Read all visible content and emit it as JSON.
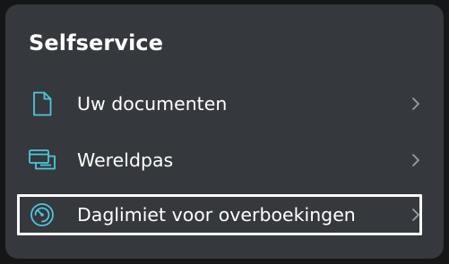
{
  "section": {
    "title": "Selfservice"
  },
  "items": [
    {
      "label": "Uw documenten",
      "icon": "document-icon"
    },
    {
      "label": "Wereldpas",
      "icon": "cards-icon"
    },
    {
      "label": "Daglimiet voor overboekingen",
      "icon": "speedometer-icon"
    }
  ],
  "colors": {
    "background": "#151618",
    "card": "#35383c",
    "accent": "#4ec6dd",
    "text": "#ffffff",
    "chevron": "#9aa0a6",
    "focus_outline": "#ffffff"
  }
}
